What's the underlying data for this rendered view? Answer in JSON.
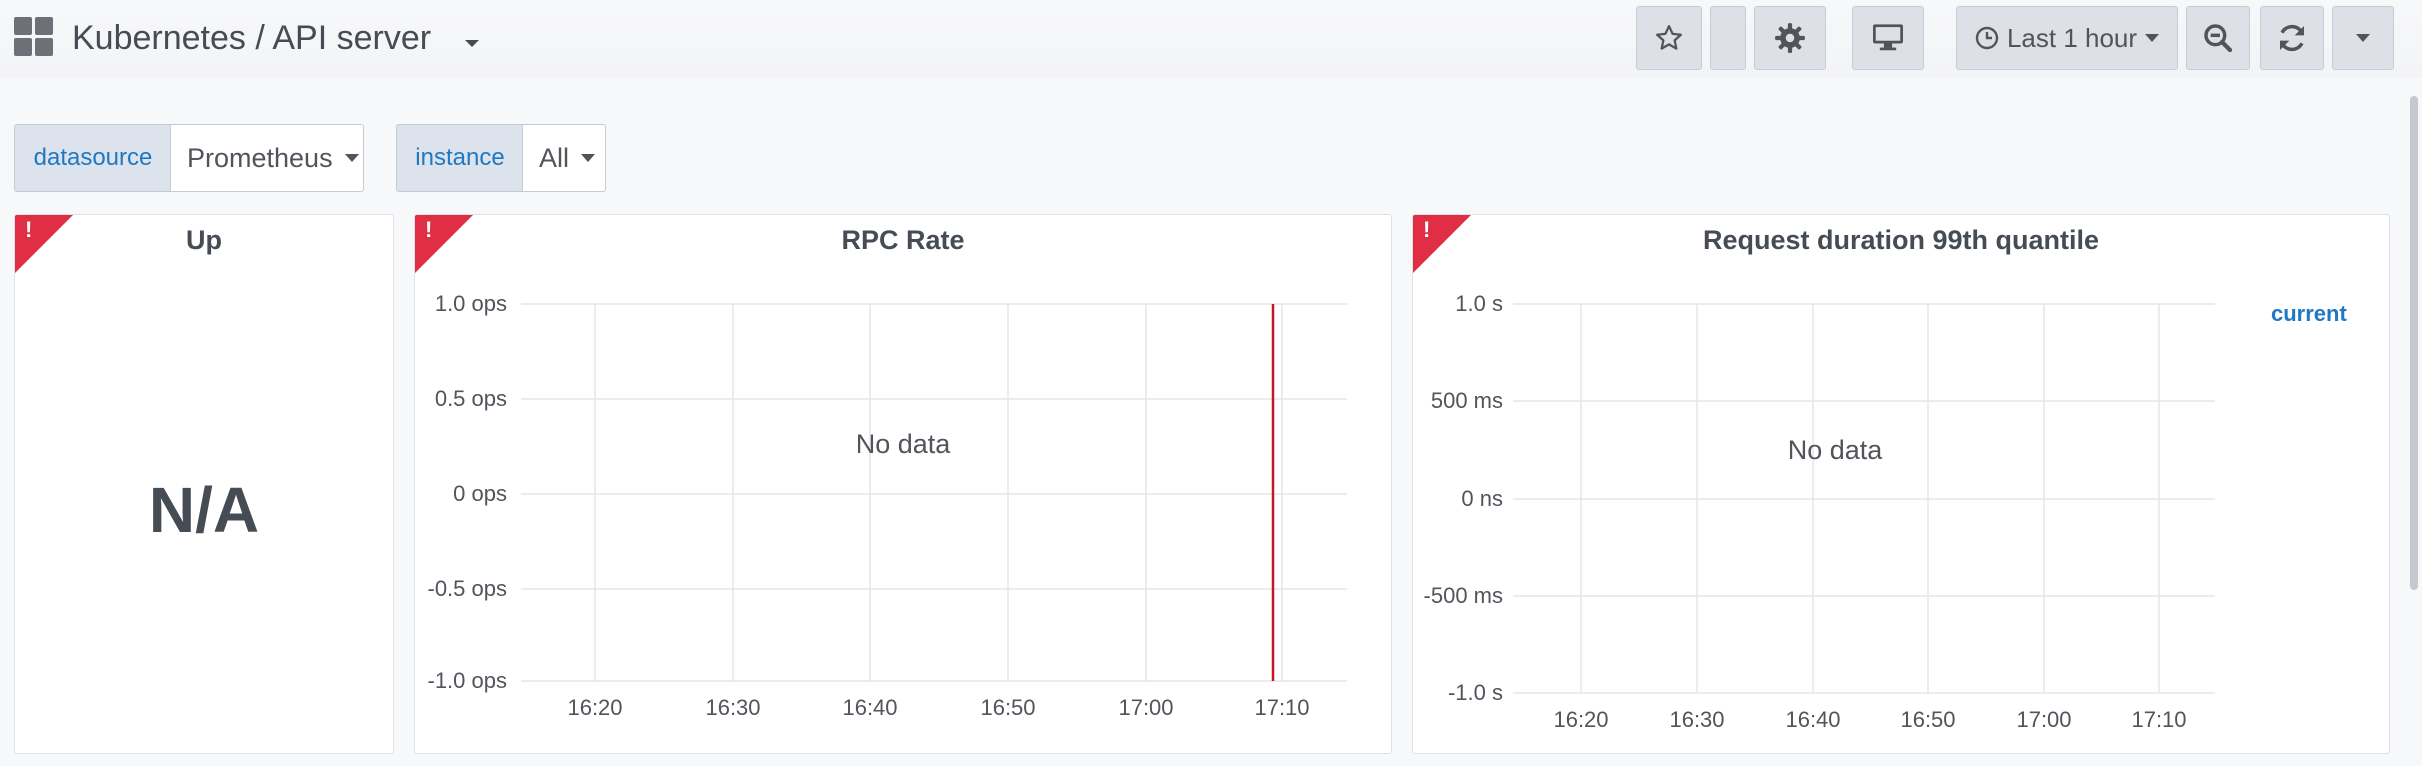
{
  "header": {
    "title": "Kubernetes / API server",
    "time_range_label": "Last 1 hour"
  },
  "variables": [
    {
      "label": "datasource",
      "value": "Prometheus"
    },
    {
      "label": "instance",
      "value": "All"
    }
  ],
  "panels": {
    "up": {
      "title": "Up",
      "value": "N/A",
      "error_mark": "!"
    },
    "rpc_rate": {
      "title": "RPC Rate",
      "no_data": "No data",
      "error_mark": "!",
      "y_ticks": [
        "1.0 ops",
        "0.5 ops",
        "0 ops",
        "-0.5 ops",
        "-1.0 ops"
      ],
      "x_ticks": [
        "16:20",
        "16:30",
        "16:40",
        "16:50",
        "17:00",
        "17:10"
      ]
    },
    "request_duration": {
      "title": "Request duration 99th quantile",
      "no_data": "No data",
      "error_mark": "!",
      "legend_current": "current",
      "y_ticks": [
        "1.0 s",
        "500 ms",
        "0 ns",
        "-500 ms",
        "-1.0 s"
      ],
      "x_ticks": [
        "16:20",
        "16:30",
        "16:40",
        "16:50",
        "17:00",
        "17:10"
      ]
    }
  },
  "colors": {
    "error_corner": "#e02f44",
    "variable_label": "#1f78c1",
    "annotation_line": "#c4162a"
  },
  "icons": [
    "grid-icon",
    "star-icon",
    "gear-icon",
    "monitor-icon",
    "clock-icon",
    "zoom-out-icon",
    "refresh-icon",
    "chevron-down-icon"
  ]
}
